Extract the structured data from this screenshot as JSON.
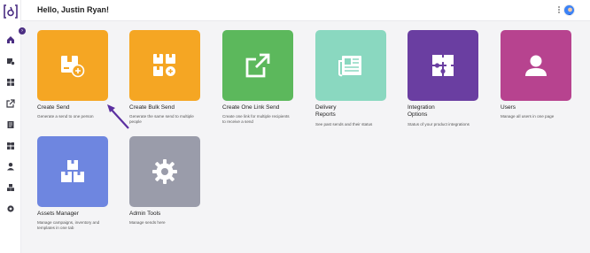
{
  "header": {
    "greeting": "Hello, Justin Ryan!"
  },
  "sidebar": {
    "items": [
      {
        "icon": "home-icon"
      },
      {
        "icon": "send-box-icon"
      },
      {
        "icon": "grid-icon"
      },
      {
        "icon": "external-link-icon"
      },
      {
        "icon": "report-icon"
      },
      {
        "icon": "puzzle-icon"
      },
      {
        "icon": "user-icon"
      },
      {
        "icon": "boxes-icon"
      },
      {
        "icon": "gear-icon"
      }
    ]
  },
  "cards": [
    {
      "title": "Create Send",
      "desc": "Generate a send to one person",
      "color": "#f5a623"
    },
    {
      "title": "Create Bulk Send",
      "desc": "Generate the same send to multiple\npeople",
      "color": "#f5a623"
    },
    {
      "title": "Create One Link Send",
      "desc": "Create one link for multiple recipients\nto receive a send",
      "color": "#5cb85c"
    },
    {
      "title": "Delivery\nReports",
      "desc": "See past sends and their status",
      "color": "#8ad8c0"
    },
    {
      "title": "Integration\nOptions",
      "desc": "Status of your product integrations",
      "color": "#6a3ea1"
    },
    {
      "title": "Users",
      "desc": "Manage all users in one page",
      "color": "#b7438f"
    },
    {
      "title": "Assets Manager",
      "desc": "Manage campaigns, inventory and\ntemplates in one tab",
      "color": "#6e86e0"
    },
    {
      "title": "Admin Tools",
      "desc": "Manage sends here",
      "color": "#9a9caa"
    }
  ],
  "colors": {
    "brand": "#4b2e83",
    "annotation_arrow": "#5b2fa0"
  }
}
